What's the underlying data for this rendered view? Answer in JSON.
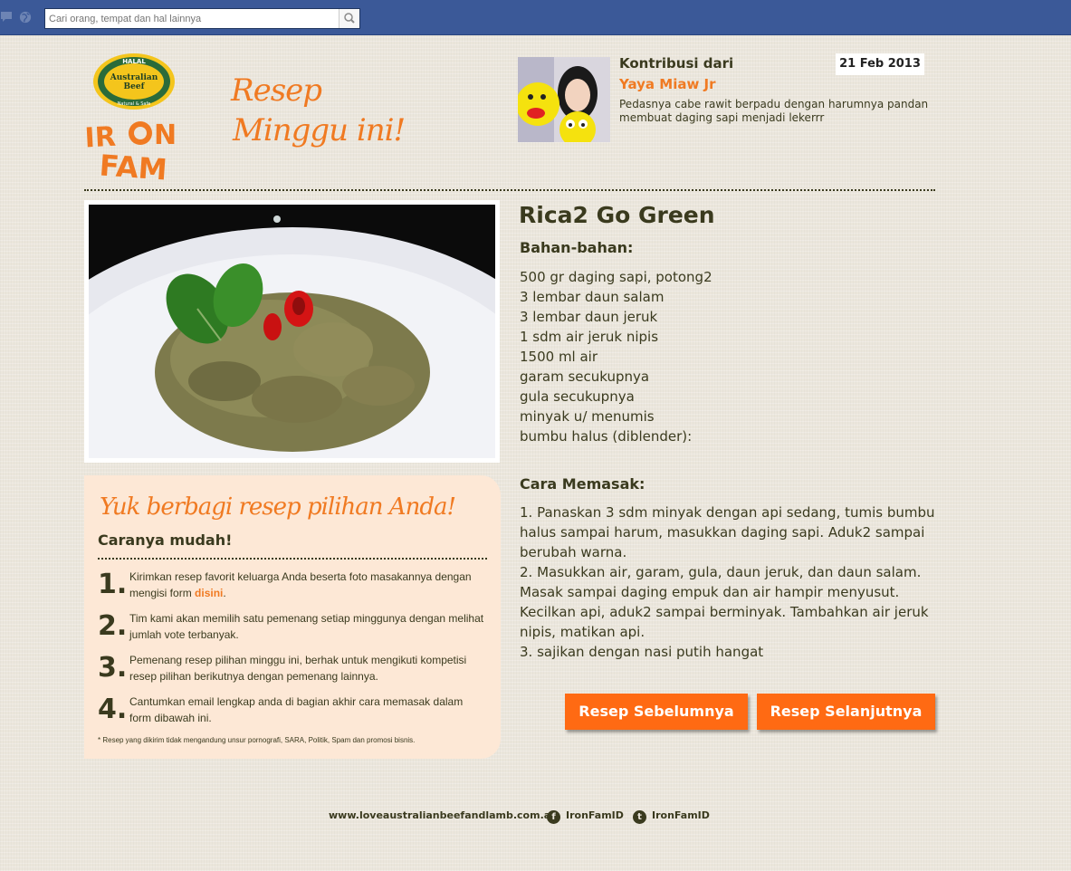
{
  "topbar": {
    "search_placeholder": "Cari orang, tempat dan hal lainnya"
  },
  "header": {
    "logo_halal_text": "Australian Beef",
    "logo_brand_text": "IRON FAM",
    "title_line1": "Resep",
    "title_line2": "Minggu ini!"
  },
  "contributor": {
    "label": "Kontribusi dari",
    "name": "Yaya Miaw Jr",
    "description": "Pedasnya cabe rawit berpadu dengan harumnya pandan membuat daging sapi menjadi lekerrr",
    "date": "21 Feb 2013"
  },
  "share": {
    "title": "Yuk berbagi resep pilihan Anda!",
    "subtitle": "Caranya mudah!",
    "steps": [
      {
        "num": "1.",
        "text": "Kirimkan resep favorit keluarga Anda beserta foto masakannya dengan mengisi form ",
        "link": "disini",
        "after": "."
      },
      {
        "num": "2.",
        "text": "Tim kami akan memilih satu pemenang setiap minggunya dengan melihat jumlah vote terbanyak."
      },
      {
        "num": "3.",
        "text": "Pemenang resep pilihan minggu ini, berhak untuk mengikuti kompetisi resep pilihan berikutnya dengan pemenang lainnya."
      },
      {
        "num": "4.",
        "text": "Cantumkan email lengkap anda di bagian akhir cara memasak dalam form dibawah ini."
      }
    ],
    "note": "* Resep yang dikirim tidak mengandung unsur pornografi, SARA, Politik, Spam dan promosi bisnis."
  },
  "recipe": {
    "title": "Rica2 Go Green",
    "ingredients_heading": "Bahan-bahan:",
    "ingredients": [
      "500 gr daging sapi, potong2",
      "3 lembar daun salam",
      "3 lembar daun jeruk",
      "1 sdm air jeruk nipis",
      "1500 ml air",
      "garam secukupnya",
      "gula secukupnya",
      "minyak u/ menumis",
      "bumbu halus (diblender):"
    ],
    "method_heading": "Cara Memasak:",
    "method": [
      "1. Panaskan 3 sdm minyak dengan api sedang, tumis bumbu halus sampai harum, masukkan daging sapi. Aduk2 sampai berubah warna.",
      "2. Masukkan air, garam, gula, daun jeruk, dan daun salam. Masak sampai daging empuk dan air hampir menyusut. Kecilkan api, aduk2 sampai berminyak. Tambahkan air jeruk nipis, matikan api.",
      "3. sajikan dengan nasi putih hangat"
    ],
    "prev_button": "Resep Sebelumnya",
    "next_button": "Resep Selanjutnya"
  },
  "footer": {
    "url": "www.loveaustralianbeefandlamb.com.au",
    "facebook": "IronFamID",
    "twitter": "IronFamID"
  },
  "colors": {
    "accent_orange": "#f07a22",
    "button_orange": "#ff6a13",
    "text_dark": "#3a3a1e",
    "fb_blue": "#3b5998",
    "share_bg": "#fde8d6"
  }
}
